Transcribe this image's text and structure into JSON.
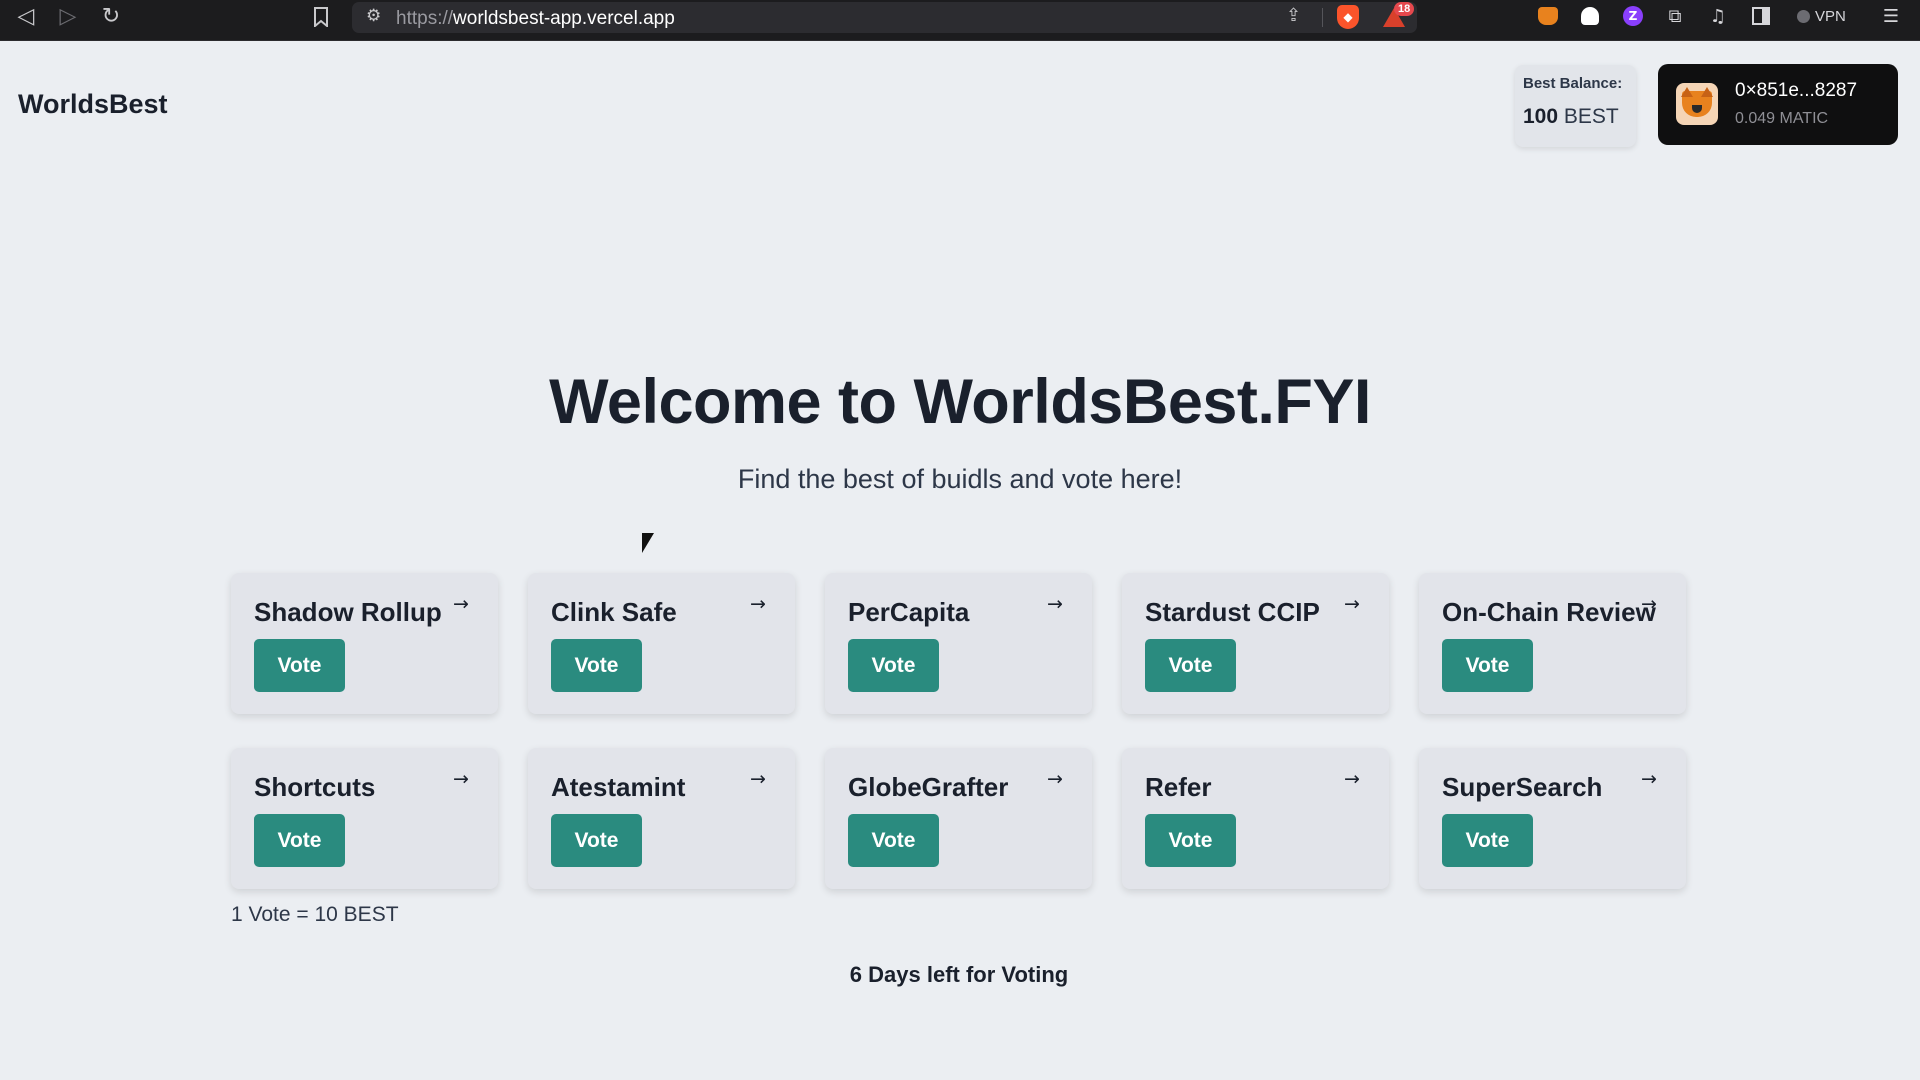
{
  "browser": {
    "url_protocol": "https://",
    "url_host": "worldsbest-app.vercel.app",
    "rewards_count": "18",
    "vpn_label": "VPN"
  },
  "header": {
    "brand": "WorldsBest",
    "balance_label": "Best Balance:",
    "balance_amount": "100",
    "balance_unit": "BEST",
    "wallet_address": "0×851e...8287",
    "wallet_balance": "0.049 MATIC"
  },
  "hero": {
    "title": "Welcome to WorldsBest.FYI",
    "subtitle": "Find the best of buidls and vote here!"
  },
  "projects": [
    {
      "name": "Shadow Rollup",
      "vote_label": "Vote"
    },
    {
      "name": "Clink Safe",
      "vote_label": "Vote"
    },
    {
      "name": "PerCapita",
      "vote_label": "Vote"
    },
    {
      "name": "Stardust CCIP",
      "vote_label": "Vote"
    },
    {
      "name": "On-Chain Review",
      "vote_label": "Vote"
    },
    {
      "name": "Shortcuts",
      "vote_label": "Vote"
    },
    {
      "name": "Atestamint",
      "vote_label": "Vote"
    },
    {
      "name": "GlobeGrafter",
      "vote_label": "Vote"
    },
    {
      "name": "Refer",
      "vote_label": "Vote"
    },
    {
      "name": "SuperSearch",
      "vote_label": "Vote"
    }
  ],
  "footer": {
    "vote_rate": "1 Vote = 10 BEST",
    "days_left": "6 Days left for Voting"
  },
  "colors": {
    "accent": "#2a8b7f",
    "background": "#ebeef2",
    "wallet_bg": "#0f0f10"
  },
  "icons": [
    "back-icon",
    "forward-icon",
    "reload-icon",
    "bookmark-icon",
    "site-settings-icon",
    "share-icon",
    "brave-shield-icon",
    "brave-rewards-icon",
    "metamask-extension-icon",
    "ghost-extension-icon",
    "purple-extension-icon",
    "extensions-puzzle-icon",
    "media-icon",
    "sidebar-icon",
    "vpn-icon",
    "menu-icon",
    "metamask-fox-icon",
    "arrow-right-icon"
  ]
}
